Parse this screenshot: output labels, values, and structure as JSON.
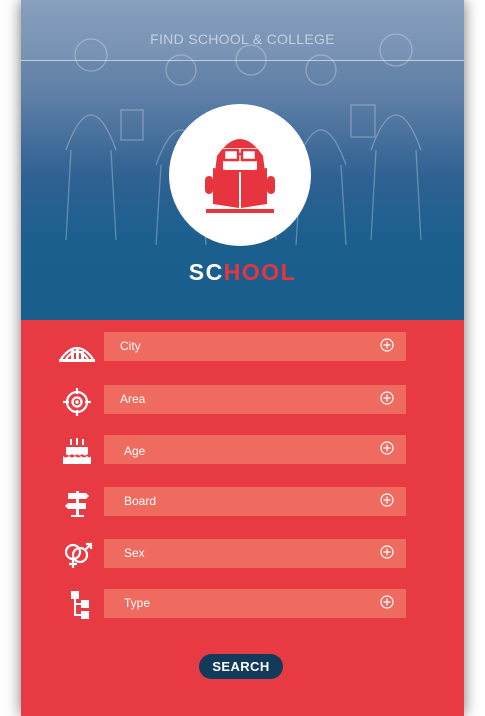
{
  "header": {
    "title": "FIND SCHOOL & COLLEGE"
  },
  "brand": {
    "part1": "SC",
    "part2": "HOOL"
  },
  "fields": [
    {
      "label": "City",
      "icon": "city-icon"
    },
    {
      "label": "Area",
      "icon": "area-target-icon"
    },
    {
      "label": "Age",
      "icon": "age-cake-icon"
    },
    {
      "label": "Board",
      "icon": "board-signpost-icon"
    },
    {
      "label": "Sex",
      "icon": "gender-icon"
    },
    {
      "label": "Type",
      "icon": "type-hierarchy-icon"
    }
  ],
  "search_button": {
    "label": "SEARCH"
  },
  "colors": {
    "primary_red": "#e83a43",
    "field_bg": "#ef6b5f",
    "hero_blue": "#1a5e8e",
    "button_navy": "#123a5a"
  }
}
